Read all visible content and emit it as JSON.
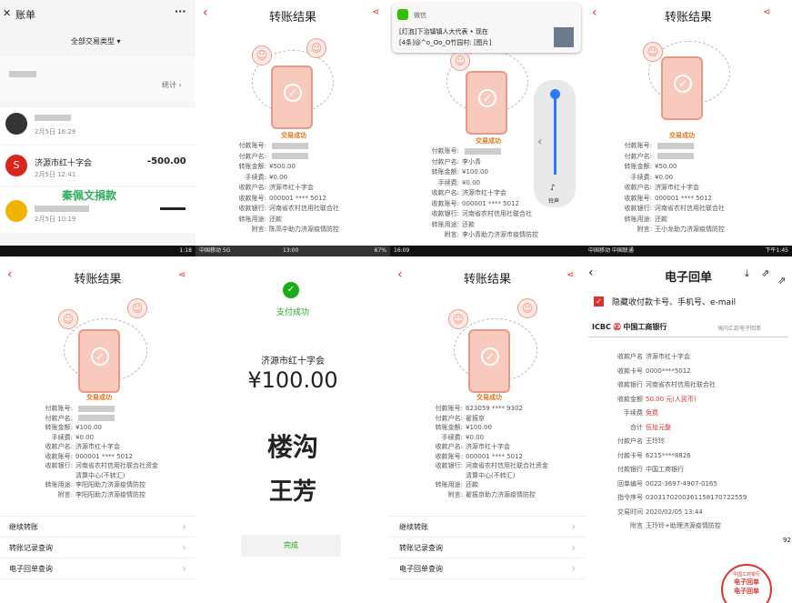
{
  "panel1": {
    "back": "✕",
    "title": "账单",
    "more": "···",
    "filter": "全部交易类型",
    "stats": "统计",
    "items": [
      {
        "date": "2月5日 16:28",
        "amount": ""
      },
      {
        "name": "济源市红十字会",
        "date": "2月5日 12:41",
        "amount": "-500.00"
      },
      {
        "name": "秦佩文捐款",
        "date": "2月5日 10:19",
        "amount": ""
      }
    ]
  },
  "panel2": {
    "title": "转账结果",
    "status": "交易成功",
    "rows": [
      {
        "k": "付款账号:",
        "v": ""
      },
      {
        "k": "付款户名:",
        "v": ""
      },
      {
        "k": "转账金额:",
        "v": "¥500.00"
      },
      {
        "k": "手续费:",
        "v": "¥0.00"
      },
      {
        "k": "收款户名:",
        "v": "济源市红十字会"
      },
      {
        "k": "收款账号:",
        "v": "000001 **** 5012"
      },
      {
        "k": "收款银行:",
        "v": "河南省农村信用社联合社"
      },
      {
        "k": "转账用途:",
        "v": "还款"
      },
      {
        "k": "附言:",
        "v": "陈高中助力济源疫情防控"
      }
    ]
  },
  "panel3": {
    "notif_app": "微信",
    "notif_line1": "[灯泡]下治镇镇人大代表 • 现在",
    "notif_line2": "[4条]@^o_Oo_O竹园村: [图片]",
    "ring": "铃声",
    "status": "交易成功",
    "rows": [
      {
        "k": "付款账号:",
        "v": ""
      },
      {
        "k": "付款户名:",
        "v": "李小青"
      },
      {
        "k": "转账金额:",
        "v": "¥100.00"
      },
      {
        "k": "手续费:",
        "v": "¥0.00"
      },
      {
        "k": "收款户名:",
        "v": "济源市红十字会"
      },
      {
        "k": "收款账号:",
        "v": "000001 **** 5012"
      },
      {
        "k": "收款银行:",
        "v": "河南省农村信用社联合社"
      },
      {
        "k": "转账用途:",
        "v": "还款"
      },
      {
        "k": "附言:",
        "v": "李小青助力济源市疫情防控"
      }
    ]
  },
  "panel4": {
    "title": "转账结果",
    "status": "交易成功",
    "rows": [
      {
        "k": "付款账号:",
        "v": ""
      },
      {
        "k": "付款户名:",
        "v": ""
      },
      {
        "k": "转账金额:",
        "v": "¥50.00"
      },
      {
        "k": "手续费:",
        "v": "¥0.00"
      },
      {
        "k": "收款户名:",
        "v": "济源市红十字会"
      },
      {
        "k": "收款账号:",
        "v": "000001 **** 5012"
      },
      {
        "k": "收款银行:",
        "v": "河南省农村信用社联合社"
      },
      {
        "k": "转账用途:",
        "v": "还款"
      },
      {
        "k": "附言:",
        "v": "王小龙助力济源疫情防控"
      }
    ]
  },
  "panel5": {
    "status_time": "1:18",
    "title": "转账结果",
    "status": "交易成功",
    "rows": [
      {
        "k": "付款账号:",
        "v": ""
      },
      {
        "k": "付款户名:",
        "v": ""
      },
      {
        "k": "转账金额:",
        "v": "¥100.00"
      },
      {
        "k": "手续费:",
        "v": "¥0.00"
      },
      {
        "k": "收款户名:",
        "v": "济源市红十字会"
      },
      {
        "k": "收款账号:",
        "v": "000001 **** 5012"
      },
      {
        "k": "收款银行:",
        "v": "河南省农村信用社联合社资金"
      },
      {
        "k": "",
        "v": "清算中心(不转汇)"
      },
      {
        "k": "转账用途:",
        "v": "李阳阳助力济源疫情防控"
      },
      {
        "k": "附言:",
        "v": "李阳阳助力济源疫情防控"
      }
    ],
    "list": [
      "继续转账",
      "转账记录查询",
      "电子回单查询"
    ]
  },
  "panel6": {
    "status_left": "中国移动 5G",
    "status_time": "13:00",
    "status_right": "67%",
    "pay_status": "支付成功",
    "payee": "济源市红十字会",
    "amount": "¥100.00",
    "hand1": "楼沟",
    "hand2": "王芳",
    "done": "完成"
  },
  "panel7": {
    "status_time": "16:09",
    "title": "转账结果",
    "status": "交易成功",
    "rows": [
      {
        "k": "付款账号:",
        "v": "623059 **** 9302"
      },
      {
        "k": "付款户名:",
        "v": "翟振京"
      },
      {
        "k": "转账金额:",
        "v": "¥100.00"
      },
      {
        "k": "手续费:",
        "v": "¥0.00"
      },
      {
        "k": "收款户名:",
        "v": "济源市红十字会"
      },
      {
        "k": "收款账号:",
        "v": "000001 **** 5012"
      },
      {
        "k": "收款银行:",
        "v": "河南省农村信用社联合社资金"
      },
      {
        "k": "",
        "v": "清算中心(不转汇)"
      },
      {
        "k": "转账用途:",
        "v": "还款"
      },
      {
        "k": "附言:",
        "v": "翟振京助力济源疫情防控"
      }
    ],
    "list": [
      "继续转账",
      "转账记录查询",
      "电子回单查询"
    ]
  },
  "panel8": {
    "status_left": "中国移动 中国联通",
    "status_time": "下午1:45",
    "title": "电子回单",
    "hide": "隐藏收付款卡号、手机号、e-mail",
    "bank_en": "ICBC",
    "bank_cn": "中国工商银行",
    "doc_type": "境内汇款电子回单",
    "rows": [
      {
        "k": "收款户名",
        "v": "济源市红十字会"
      },
      {
        "k": "收款卡号",
        "v": "0000****5012"
      },
      {
        "k": "收款银行",
        "v": "河南省农村信用社联合社"
      },
      {
        "k": "收款金额",
        "v": "50.00 元(人民币)"
      },
      {
        "k": "手续费",
        "v": "免费"
      },
      {
        "k": "合计",
        "v": "伍拾元整"
      },
      {
        "k": "付款户名",
        "v": "王玲玲"
      },
      {
        "k": "付款卡号",
        "v": "6215****8826"
      },
      {
        "k": "付款银行",
        "v": "中国工商银行"
      },
      {
        "k": "回单编号",
        "v": "0022-3697-4907-0165"
      },
      {
        "k": "指令序号",
        "v": "0303170200361158170722559"
      },
      {
        "k": "交易时间",
        "v": "2020/02/05 13:44"
      },
      {
        "k": "附言",
        "v": "王玲玲+助理济源疫情防控"
      }
    ],
    "stamp1": "中国工商银行",
    "stamp2": "电子回单",
    "stamp3": "电子回单",
    "side_num": "92"
  }
}
